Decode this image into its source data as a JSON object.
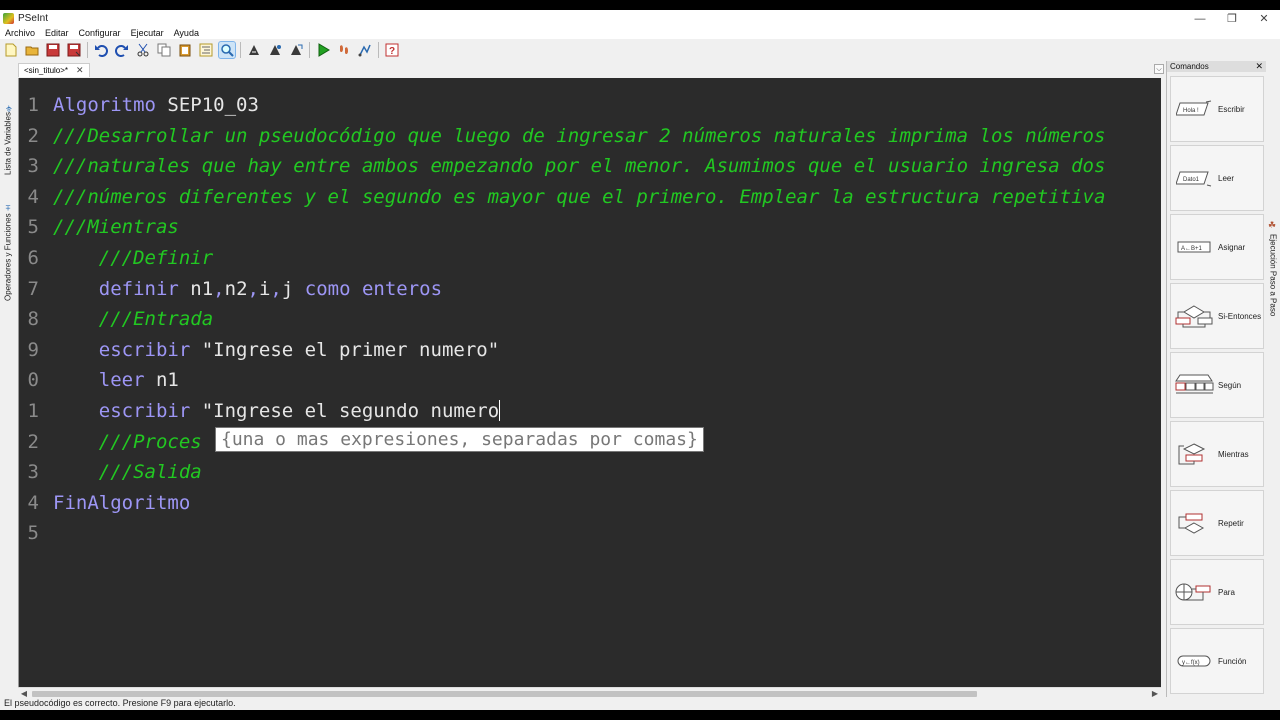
{
  "window": {
    "title": "PSeInt",
    "controls": [
      "—",
      "❐",
      "✕"
    ]
  },
  "menu": [
    "Archivo",
    "Editar",
    "Configurar",
    "Ejecutar",
    "Ayuda"
  ],
  "left_panel": {
    "variables_label": "Lista de Variables",
    "operators_label": "Operadores y Funciones"
  },
  "document": {
    "tab_label": "<sin_titulo>*",
    "tab_close": "✕",
    "dropdown": "⌵"
  },
  "editor": {
    "lines": [
      {
        "num": "1",
        "tokens": [
          {
            "t": "Algoritmo",
            "c": "kw"
          },
          {
            "t": " SEP10_03",
            "c": "id"
          }
        ]
      },
      {
        "num": "2",
        "tokens": [
          {
            "t": "///Desarrollar un pseudocódigo que luego de ingresar 2 números naturales imprima los números",
            "c": "cm"
          }
        ]
      },
      {
        "num": "3",
        "tokens": [
          {
            "t": "///naturales que hay entre ambos empezando por el menor. Asumimos que el usuario ingresa dos",
            "c": "cm"
          }
        ]
      },
      {
        "num": "4",
        "tokens": [
          {
            "t": "///números diferentes y el segundo es mayor que el primero. Emplear la estructura repetitiva",
            "c": "cm"
          }
        ]
      },
      {
        "num": "5",
        "tokens": [
          {
            "t": "///Mientras",
            "c": "cm"
          }
        ]
      },
      {
        "num": "6",
        "tokens": [
          {
            "t": "    ",
            "c": "id"
          },
          {
            "t": "///Definir",
            "c": "cm"
          }
        ]
      },
      {
        "num": "7",
        "tokens": [
          {
            "t": "    ",
            "c": "id"
          },
          {
            "t": "definir",
            "c": "kw"
          },
          {
            "t": " n1",
            "c": "id"
          },
          {
            "t": ",",
            "c": "pn"
          },
          {
            "t": "n2",
            "c": "id"
          },
          {
            "t": ",",
            "c": "pn"
          },
          {
            "t": "i",
            "c": "id"
          },
          {
            "t": ",",
            "c": "pn"
          },
          {
            "t": "j ",
            "c": "id"
          },
          {
            "t": "como enteros",
            "c": "kw"
          }
        ]
      },
      {
        "num": "8",
        "tokens": [
          {
            "t": "    ",
            "c": "id"
          },
          {
            "t": "///Entrada",
            "c": "cm"
          }
        ]
      },
      {
        "num": "9",
        "tokens": [
          {
            "t": "    ",
            "c": "id"
          },
          {
            "t": "escribir",
            "c": "kw"
          },
          {
            "t": " \"Ingrese el primer numero\"",
            "c": "str"
          }
        ]
      },
      {
        "num": "0",
        "tokens": [
          {
            "t": "    ",
            "c": "id"
          },
          {
            "t": "leer",
            "c": "kw"
          },
          {
            "t": " n1",
            "c": "id"
          }
        ]
      },
      {
        "num": "1",
        "tokens": [
          {
            "t": "    ",
            "c": "id"
          },
          {
            "t": "escribir",
            "c": "kw"
          },
          {
            "t": " \"Ingrese el segundo numero",
            "c": "str"
          }
        ],
        "caret": true
      },
      {
        "num": "2",
        "tokens": [
          {
            "t": "    ",
            "c": "id"
          },
          {
            "t": "///Proces",
            "c": "cm"
          }
        ]
      },
      {
        "num": "3",
        "tokens": [
          {
            "t": "    ",
            "c": "id"
          },
          {
            "t": "///Salida",
            "c": "cm"
          }
        ]
      },
      {
        "num": "4",
        "tokens": [
          {
            "t": "FinAlgoritmo",
            "c": "kw"
          }
        ]
      },
      {
        "num": "5",
        "tokens": []
      }
    ],
    "calltip": "{una o mas expresiones, separadas por comas}"
  },
  "status": "El pseudocódigo es correcto. Presione F9 para ejecutarlo.",
  "commands": {
    "title": "Comandos",
    "close": "✕",
    "items": [
      {
        "label": "Escribir",
        "icon_text": "Hola !"
      },
      {
        "label": "Leer",
        "icon_text": "Dato1"
      },
      {
        "label": "Asignar",
        "icon_text": "A←B+1"
      },
      {
        "label": "Si-Entonces",
        "icon_text": ""
      },
      {
        "label": "Según",
        "icon_text": ""
      },
      {
        "label": "Mientras",
        "icon_text": ""
      },
      {
        "label": "Repetir",
        "icon_text": ""
      },
      {
        "label": "Para",
        "icon_text": ""
      },
      {
        "label": "Función",
        "icon_text": "y←f(x)"
      }
    ]
  },
  "right_panel": {
    "step_label": "Ejecución Paso a Paso"
  }
}
